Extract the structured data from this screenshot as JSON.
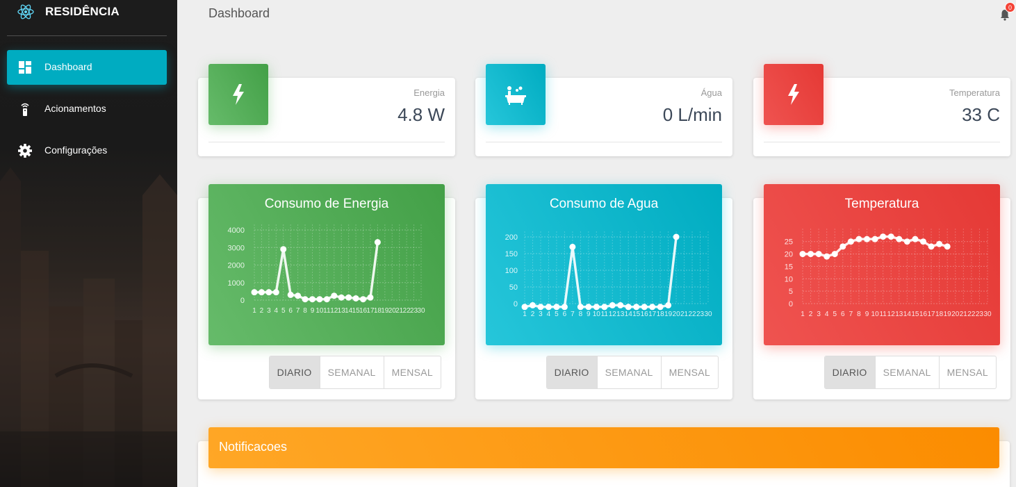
{
  "app": {
    "brand": "RESIDÊNCIA"
  },
  "sidebar": {
    "items": [
      {
        "label": "Dashboard",
        "icon": "dashboard-icon",
        "active": true
      },
      {
        "label": "Acionamentos",
        "icon": "remote-icon",
        "active": false
      },
      {
        "label": "Configurações",
        "icon": "gear-icon",
        "active": false
      }
    ]
  },
  "header": {
    "title": "Dashboard",
    "notifications_count": "0"
  },
  "stats": [
    {
      "label": "Energia",
      "value": "4.8 W",
      "icon": "lightning-icon",
      "color": "#4caf50"
    },
    {
      "label": "Água",
      "value": "0 L/min",
      "icon": "bathtub-icon",
      "color": "#00bcd4"
    },
    {
      "label": "Temperatura",
      "value": "33 C",
      "icon": "lightning-icon",
      "color": "#f44336"
    }
  ],
  "period_buttons": [
    "DIARIO",
    "SEMANAL",
    "MENSAL"
  ],
  "chart_data": [
    {
      "type": "line",
      "title": "Consumo de Energia",
      "x": [
        "1",
        "2",
        "3",
        "4",
        "5",
        "6",
        "7",
        "8",
        "9",
        "10",
        "11",
        "12",
        "13",
        "14",
        "15",
        "16",
        "17",
        "18",
        "19",
        "20",
        "21",
        "22",
        "23",
        "30"
      ],
      "yticks": [
        0,
        1000,
        2000,
        3000,
        4000
      ],
      "ylim": [
        0,
        4000
      ],
      "series": [
        {
          "values": [
            450,
            450,
            450,
            450,
            2900,
            300,
            250,
            50,
            50,
            50,
            50,
            250,
            150,
            150,
            100,
            50,
            150,
            3300
          ]
        }
      ],
      "color": "#4caf50",
      "grid": true
    },
    {
      "type": "line",
      "title": "Consumo de Agua",
      "x": [
        "1",
        "2",
        "3",
        "4",
        "5",
        "6",
        "7",
        "8",
        "9",
        "10",
        "11",
        "12",
        "13",
        "14",
        "15",
        "16",
        "17",
        "18",
        "19",
        "20",
        "21",
        "22",
        "23",
        "30"
      ],
      "yticks": [
        0,
        50,
        100,
        150,
        200
      ],
      "ylim": [
        0,
        200
      ],
      "series": [
        {
          "values": [
            -10,
            -5,
            -10,
            -10,
            -10,
            -10,
            170,
            -10,
            -10,
            -10,
            -10,
            -5,
            -5,
            -10,
            -10,
            -10,
            -10,
            -10,
            -5,
            200
          ]
        }
      ],
      "color": "#00bcd4",
      "grid": true
    },
    {
      "type": "line",
      "title": "Temperatura",
      "x": [
        "1",
        "2",
        "3",
        "4",
        "5",
        "6",
        "7",
        "8",
        "9",
        "10",
        "11",
        "12",
        "13",
        "14",
        "15",
        "16",
        "17",
        "18",
        "19",
        "20",
        "21",
        "22",
        "23",
        "30"
      ],
      "yticks": [
        0,
        5,
        10,
        15,
        20,
        25
      ],
      "ylim": [
        0,
        28
      ],
      "series": [
        {
          "values": [
            20,
            20,
            20,
            19,
            20,
            23,
            25,
            26,
            26,
            26,
            27,
            27,
            26,
            25,
            26,
            25,
            23,
            24,
            23
          ]
        }
      ],
      "color": "#f44336",
      "grid": true
    }
  ],
  "notifications": {
    "title": "Notificacoes"
  }
}
